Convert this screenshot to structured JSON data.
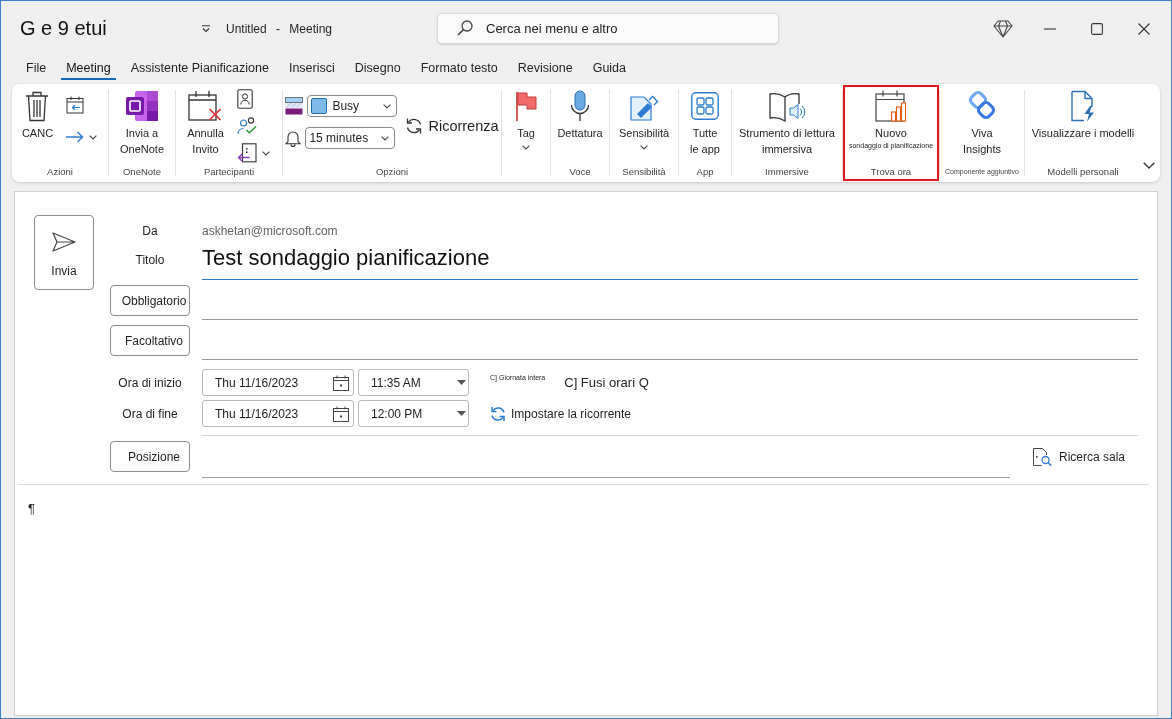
{
  "window": {
    "title": "G e 9 etui",
    "document": "Untitled - Meeting"
  },
  "search": {
    "placeholder": "Cerca nei menu e altro"
  },
  "menu_tabs": [
    {
      "label": "File",
      "selected": false
    },
    {
      "label": "Meeting",
      "selected": true
    },
    {
      "label": "Assistente Pianificazione",
      "selected": false
    },
    {
      "label": "Inserisci",
      "selected": false
    },
    {
      "label": "Disegno",
      "selected": false
    },
    {
      "label": "Formato testo",
      "selected": false
    },
    {
      "label": "Revisione",
      "selected": false
    },
    {
      "label": "Guida",
      "selected": false
    }
  ],
  "ribbon": {
    "groups": [
      {
        "label": "Azioni",
        "highlighted": false,
        "items": [
          {
            "kind": "large",
            "label": "CANC",
            "menu": false
          },
          {
            "kind": "column",
            "items": [
              {
                "kind": "small",
                "menu": false
              },
              {
                "kind": "small",
                "menu": true
              }
            ]
          }
        ]
      },
      {
        "label": "OneNote",
        "highlighted": false,
        "items": [
          {
            "kind": "large",
            "label": "Invia a\nOneNote",
            "menu": false
          }
        ]
      },
      {
        "label": "Partecipanti",
        "highlighted": false,
        "items": [
          {
            "kind": "large",
            "label": "Annulla\nInvito",
            "menu": false
          },
          {
            "kind": "column",
            "items": [
              {
                "kind": "small",
                "menu": false
              },
              {
                "kind": "small",
                "menu": false
              },
              {
                "kind": "small",
                "menu": true
              }
            ]
          }
        ]
      },
      {
        "label": "Opzioni",
        "highlighted": false,
        "items": [
          {
            "kind": "column",
            "items": [
              {
                "kind": "dropdown",
                "value": "Busy"
              },
              {
                "kind": "dropdown",
                "value": "15 minutes"
              }
            ]
          },
          {
            "kind": "inline",
            "label": "Ricorrenza"
          }
        ]
      },
      {
        "highlighted": false,
        "items": [
          {
            "kind": "large",
            "label": "Tag",
            "menu": true
          }
        ]
      },
      {
        "label": "Voce",
        "highlighted": false,
        "items": [
          {
            "kind": "large",
            "label": "Dettatura",
            "menu": false
          }
        ]
      },
      {
        "label": "Sensibilità",
        "highlighted": false,
        "items": [
          {
            "kind": "large",
            "label": "Sensibilità",
            "menu": true
          }
        ]
      },
      {
        "label": "App",
        "highlighted": false,
        "items": [
          {
            "kind": "large",
            "label": "Tutte\nle app",
            "menu": false
          }
        ]
      },
      {
        "label": "Immersive",
        "highlighted": false,
        "items": [
          {
            "kind": "large",
            "label": "Strumento di lettura\nimmersiva",
            "menu": false
          }
        ]
      },
      {
        "label": "Trova ora",
        "highlighted": true,
        "items": [
          {
            "kind": "large",
            "label": "Nuovo",
            "sublabel": "sondaggio di pianificazione",
            "menu": false
          }
        ]
      },
      {
        "label": "Componente aggiuntivo",
        "highlighted": false,
        "items": [
          {
            "kind": "large",
            "label": "Viva\nInsights",
            "menu": false
          }
        ]
      },
      {
        "label": "Modelli personali",
        "highlighted": false,
        "items": [
          {
            "kind": "large",
            "label": "Visualizzare i modelli",
            "menu": false
          }
        ]
      }
    ]
  },
  "form": {
    "send": {
      "label": "Invia"
    },
    "from": {
      "label": "Da",
      "value": "askhetan@microsoft.com"
    },
    "subject": {
      "label": "Titolo",
      "value": "Test sondaggio pianificazione"
    },
    "required": {
      "label": "Obbligatorio"
    },
    "optional": {
      "label": "Facoltativo"
    },
    "start": {
      "label": "Ora di inizio",
      "date": "Thu 11/16/2023",
      "time": "11:35 AM"
    },
    "end": {
      "label": "Ora di fine",
      "date": "Thu 11/16/2023",
      "time": "12:00 PM"
    },
    "all_day": {
      "label": "C] Giornata intera"
    },
    "time_zones": {
      "label": "C] Fusi orari Q"
    },
    "recurrence": {
      "label": "Impostare la ricorrente"
    },
    "location": {
      "label": "Posizione"
    },
    "room_finder": {
      "label": "Ricerca sala"
    },
    "body": {
      "text": "¶"
    }
  }
}
